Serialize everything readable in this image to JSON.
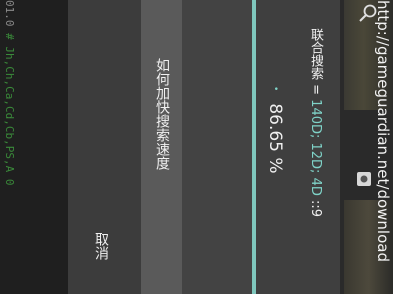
{
  "background": {
    "script_text_prefix": "01.0",
    "script_text_sep": " # ",
    "script_text_body": "Jh,Ch,Ca,Cd,Cb,PS,A 0",
    "url": "http://gameguardian.net/download"
  },
  "dialog": {
    "search_prefix": "联合搜索 = ",
    "search_values": "140D; 12D; 4D",
    "search_suffix": " ::9",
    "progress_bullet": "•",
    "progress": "86.65 %",
    "speed_button": "如何加快搜索速度",
    "cancel_button": "取消"
  },
  "colors": {
    "accent": "#7fc7bd",
    "highlight_text": "#7fd3c8",
    "dialog_bg": "#404040",
    "button_bg": "#5a5a5a"
  }
}
